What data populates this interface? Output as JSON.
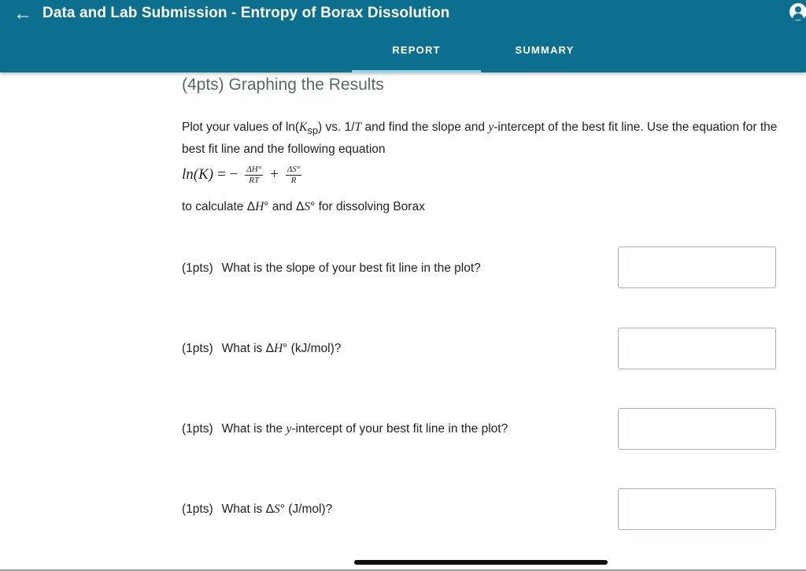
{
  "appbar": {
    "title": "Data and Lab Submission - Entropy of Borax Dissolution",
    "back_icon": "arrow-left-icon",
    "account_icon": "account-circle-icon",
    "tabs": [
      {
        "label": "REPORT",
        "selected": true
      },
      {
        "label": "SUMMARY",
        "selected": false
      }
    ],
    "color": "#0b6f8d",
    "indicator_color": "#8fd3ea"
  },
  "section": {
    "title": "(4pts) Graphing the Results",
    "intro_parts": {
      "a": "Plot your values of ln(",
      "k": "K",
      "sp": "sp",
      "b": ") vs. 1/",
      "t": "T",
      "c": " and find the slope and ",
      "y": "y",
      "d": "-intercept of the best fit line. Use the equation for the best fit line and the following equation"
    },
    "equation": {
      "lhs": "ln(K)",
      "equals": "= −",
      "frac1_num": "ΔH°",
      "frac1_den": "RT",
      "plus": "+",
      "frac2_num": "ΔS°",
      "frac2_den": "R"
    },
    "calc_parts": {
      "a": "to calculate Δ",
      "h": "H",
      "b": "° and Δ",
      "s": "S",
      "c": "° for dissolving Borax"
    }
  },
  "questions": [
    {
      "pts": "(1pts)",
      "text_a": "What is the slope of your best fit line in the plot?",
      "text_i": "",
      "text_b": "",
      "answer": ""
    },
    {
      "pts": "(1pts)",
      "text_a": "What is Δ",
      "text_i": "H",
      "text_b": "° (kJ/mol)?",
      "answer": ""
    },
    {
      "pts": "(1pts)",
      "text_a": "What is the ",
      "text_i": "y",
      "text_b": "-intercept of your best fit line in the plot?",
      "answer": ""
    },
    {
      "pts": "(1pts)",
      "text_a": "What is Δ",
      "text_i": "S",
      "text_b": "° (J/mol)?",
      "answer": ""
    }
  ]
}
